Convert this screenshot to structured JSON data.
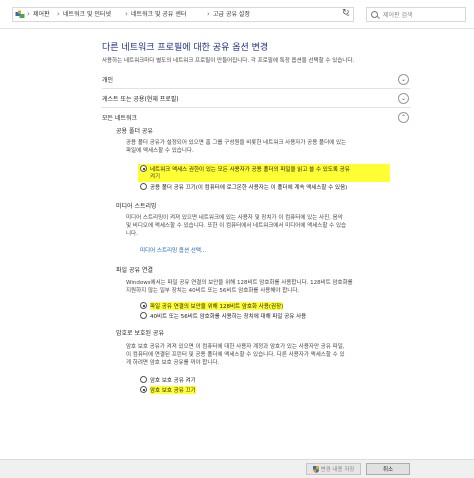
{
  "address_bar": {
    "back": "←",
    "forward": "→",
    "up": "↑",
    "crumbs": [
      "제어판",
      "네트워크 및 인터넷",
      "네트워크 및 공유 센터",
      "고급 공유 설정"
    ],
    "refresh": "↻",
    "search_placeholder": "제어판 검색"
  },
  "main": {
    "title": "다른 네트워크 프로필에 대한 공유 옵션 변경",
    "description": "사용하는 네트워크마다 별도의 네트워크 프로필이 만들어집니다. 각 프로필에 특정 옵션을 선택할 수 있습니다."
  },
  "profiles": {
    "private": {
      "label": "개인",
      "chevron": "⌄"
    },
    "guest": {
      "label": "게스트 또는 공용(현재 프로필)",
      "chevron": "⌄"
    },
    "all": {
      "label": "모든 네트워크",
      "chevron": "⌃"
    }
  },
  "public_folder": {
    "heading": "공용 폴더 공유",
    "lines": [
      "공용 폴더 공유가 설정되어 있으면 홈 그룹 구성원을 비롯한 네트워크 사용자가 공용 폴더에 있는",
      "파일에 액세스할 수 있습니다."
    ],
    "option_on_line1": "네트워크 액세스 권한이 있는 모든 사용자가 공용 폴더의 파일을 읽고 쓸 수 있도록 공유",
    "option_on_line2": "켜기",
    "option_off": "공용 폴더 공유 끄기(이 컴퓨터에 로그온한 사용자는 이 폴더에 계속 액세스할 수 있음)"
  },
  "media": {
    "heading": "미디어 스트리밍",
    "lines": [
      "미디어 스트리밍이 켜져 있으면 네트워크에 있는 사용자 및 장치가 이 컴퓨터에 있는 사진, 음악",
      "및 비디오에 액세스할 수 있습니다. 또한 이 컴퓨터에서 네트워크에서 미디어에 액세스할 수 있습",
      "니다."
    ],
    "link": "미디어 스트리밍 옵션 선택..."
  },
  "file_sharing": {
    "heading": "파일 공유 연결",
    "lines": [
      "Windows에서는 파일 공유 연결의 보안을 위해 128비트 암호화를 사용합니다. 128비트 암호화를",
      "지원하지 않는 일부 장치는 40비트 또는 56비트 암호화를 사용해야 합니다."
    ],
    "option_128": "파일 공유 연결의 보안을 위해 128비트 암호화 사용(권장)",
    "option_40": "40비트 또는 56비트 암호화를 사용하는 장치에 대해 파일 공유 사용"
  },
  "password": {
    "heading": "암호로 보호된 공유",
    "lines": [
      "암호 보호 공유가 켜져 있으면 이 컴퓨터에 대한 사용자 계정과 암호가 있는 사용자만 공유 파일,",
      "이 컴퓨터에 연결된 프린터 및 공용 폴더에 액세스할 수 있습니다. 다른 사용자가 액세스할 수 있",
      "게 하려면 암호 보호 공유를 꺼야 합니다."
    ],
    "option_on": "암호 보호 공유 켜기",
    "option_off": "암호 보호 공유 끄기"
  },
  "footer": {
    "save": "변경 내용 저장",
    "cancel": "취소"
  }
}
